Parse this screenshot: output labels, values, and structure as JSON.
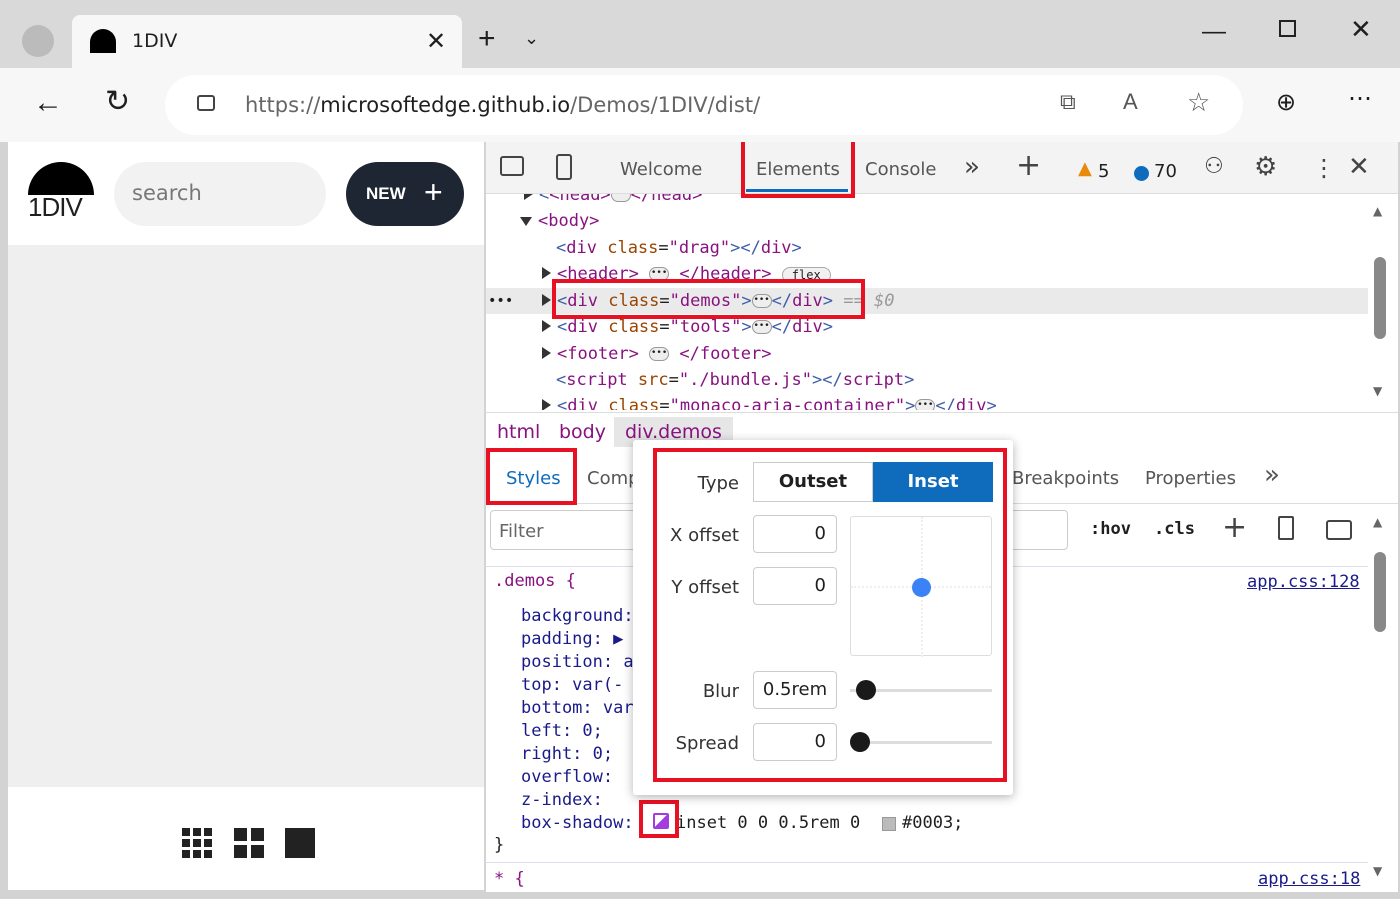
{
  "browser": {
    "tab_title": "1DIV",
    "url_prefix": "https://",
    "url_host": "microsoftedge.github.io",
    "url_path": "/Demos/1DIV/dist/"
  },
  "page": {
    "logo": "1DIV",
    "search_placeholder": "search",
    "new_button": "NEW",
    "new_icon": "+"
  },
  "devtools": {
    "tabs": [
      "Welcome",
      "Elements",
      "Console"
    ],
    "active_tab": "Elements",
    "warnings": "5",
    "messages": "70",
    "dom": [
      {
        "open": "<head>",
        "close": "</head>"
      },
      {
        "open": "<body>"
      },
      {
        "tag": "div",
        "attr": "class",
        "val": "drag"
      },
      {
        "open": "<header>",
        "close": "</header>",
        "badge": "flex"
      },
      {
        "tag": "div",
        "attr": "class",
        "val": "demos",
        "selected_marker": "== $0"
      },
      {
        "tag": "div",
        "attr": "class",
        "val": "tools"
      },
      {
        "open": "<footer>",
        "close": "</footer>"
      },
      {
        "tag": "script",
        "attr": "src",
        "val": "./bundle.js"
      },
      {
        "tag": "div",
        "attr": "class",
        "val": "monaco-aria-container"
      }
    ],
    "breadcrumbs": [
      "html",
      "body",
      "div.demos"
    ],
    "panel_tabs": [
      "Styles",
      "Comp",
      "Breakpoints",
      "Properties"
    ],
    "filter_placeholder": "Filter",
    "hov": ":hov",
    "cls": ".cls",
    "rule": {
      "selector": ".demos {",
      "source": "app.css:128",
      "props": [
        "background:",
        "padding: ▶",
        "position: a",
        "top: var(-",
        "bottom: var",
        "left: 0;",
        "right: 0;",
        "overflow: ",
        "z-index: ",
        "box-shadow:"
      ],
      "box_shadow_value": "inset 0 0 0.5rem 0",
      "box_shadow_color": "#0003;",
      "close": "}"
    },
    "rule2": {
      "selector": "* {",
      "source": "app.css:18"
    },
    "shadow_editor": {
      "type_label": "Type",
      "outset": "Outset",
      "inset": "Inset",
      "active": "Inset",
      "x_label": "X offset",
      "x": "0",
      "y_label": "Y offset",
      "y": "0",
      "blur_label": "Blur",
      "blur": "0.5rem",
      "spread_label": "Spread",
      "spread": "0",
      "blur_level": 0.05,
      "spread_level": 0
    }
  },
  "colors": {
    "accent": "#0f6cbd",
    "highlight": "#e81123"
  }
}
